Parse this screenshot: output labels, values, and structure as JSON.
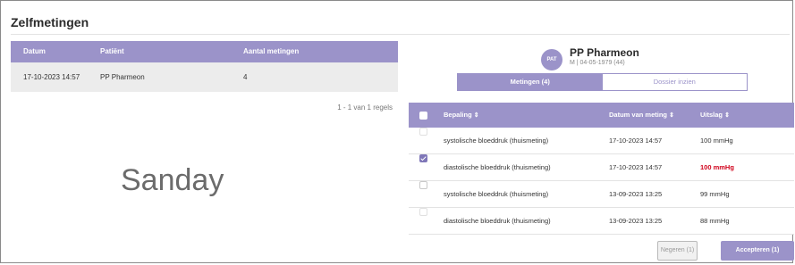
{
  "page": {
    "title": "Zelfmetingen"
  },
  "left_table": {
    "columns": [
      "Datum",
      "Patiënt",
      "Aantal metingen"
    ],
    "rows": [
      {
        "datum": "17-10-2023 14:57",
        "patient": "PP Pharmeon",
        "aantal": "4"
      }
    ],
    "pagination": "1 - 1 van 1 regels"
  },
  "watermark": "Sanday",
  "patient": {
    "avatar": "PAT",
    "name": "PP Pharmeon",
    "meta": "M | 04-05-1979 (44)"
  },
  "tabs": {
    "metingen": "Metingen (4)",
    "dossier": "Dossier inzien"
  },
  "right_table": {
    "columns": {
      "bepaling": "Bepaling",
      "datum": "Datum van meting",
      "uitslag": "Uitslag",
      "sort_icon": "⇕"
    },
    "rows": [
      {
        "bepaling": "systolische bloeddruk (thuismeting)",
        "datum": "17-10-2023 14:57",
        "uitslag": "100 mmHg",
        "checked": false,
        "alert": false
      },
      {
        "bepaling": "diastolische bloeddruk (thuismeting)",
        "datum": "17-10-2023 14:57",
        "uitslag": "100 mmHg",
        "checked": true,
        "alert": true
      },
      {
        "bepaling": "systolische bloeddruk (thuismeting)",
        "datum": "13-09-2023 13:25",
        "uitslag": "99 mmHg",
        "checked": false,
        "alert": false
      },
      {
        "bepaling": "diastolische bloeddruk (thuismeting)",
        "datum": "13-09-2023 13:25",
        "uitslag": "88 mmHg",
        "checked": false,
        "alert": false
      }
    ]
  },
  "buttons": {
    "negeren": "Negeren (1)",
    "accepteren": "Accepteren (1)"
  },
  "colors": {
    "accent": "#9b93c9",
    "alert": "#d0021b"
  }
}
